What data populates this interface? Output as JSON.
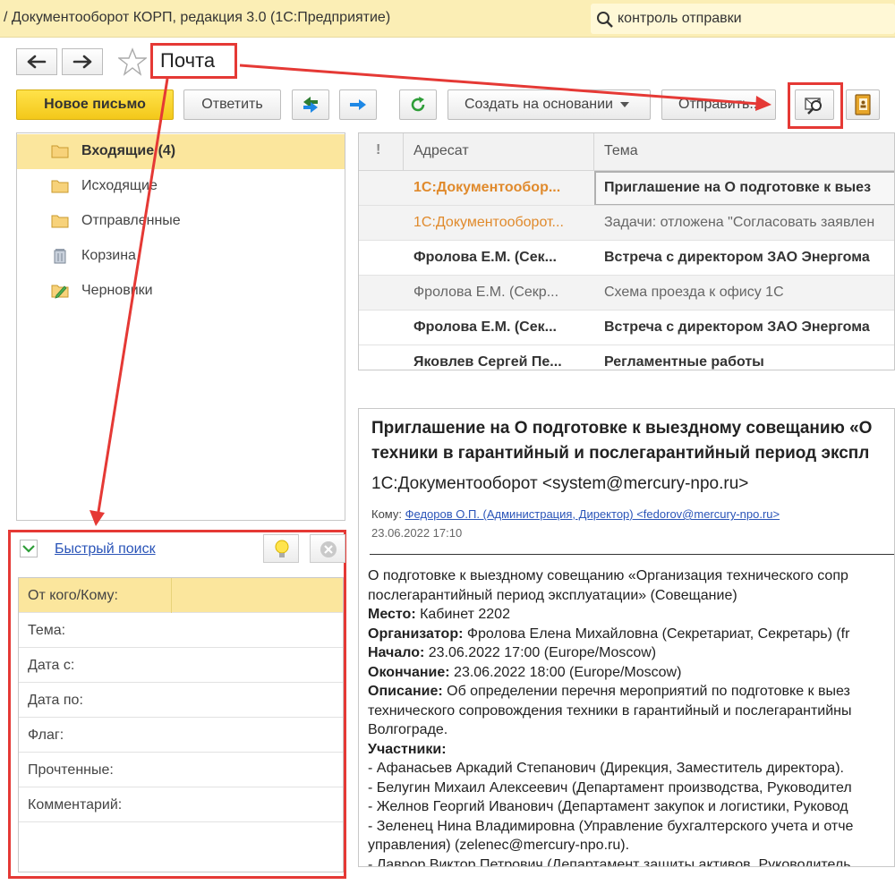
{
  "window": {
    "title": "/ Документооборот КОРП, редакция 3.0  (1С:Предприятие)",
    "search_value": "контроль отправки"
  },
  "page": {
    "title": "Почта"
  },
  "toolbar": {
    "new_letter": "Новое письмо",
    "reply": "Ответить",
    "create_based_on": "Создать на основании",
    "send": "Отправить..."
  },
  "folders": [
    {
      "label": "Входящие (4)",
      "icon": "folder-icon",
      "selected": true
    },
    {
      "label": "Исходящие",
      "icon": "folder-icon"
    },
    {
      "label": "Отправленные",
      "icon": "folder-icon"
    },
    {
      "label": "Корзина",
      "icon": "trash-icon"
    },
    {
      "label": "Черновики",
      "icon": "draft-folder-icon"
    }
  ],
  "mail_list": {
    "columns": {
      "flag": "!",
      "addressee": "Адресат",
      "subject": "Тема"
    },
    "rows": [
      {
        "from": "1С:Документообор...",
        "subject": "Приглашение на О подготовке к выез",
        "style": "bold-orange",
        "selected": true
      },
      {
        "from": "1С:Документооборот...",
        "subject": "Задачи: отложена \"Согласовать заявлен",
        "style": "orange"
      },
      {
        "from": "Фролова Е.М. (Сек...",
        "subject": "Встреча с директором ЗАО Энергома",
        "style": "bold"
      },
      {
        "from": "Фролова Е.М. (Секр...",
        "subject": "Схема проезда к офису 1С",
        "style": "grey"
      },
      {
        "from": "Фролова Е.М. (Сек...",
        "subject": "Встреча с директором ЗАО Энергома",
        "style": "bold"
      },
      {
        "from": "Яковлев Сергей Пе...",
        "subject": "Регламентные работы",
        "style": "bold"
      }
    ]
  },
  "preview": {
    "subject_line1": "Приглашение на О подготовке к выездному совещанию «О",
    "subject_line2": "техники в гарантийный и послегарантийный период экспл",
    "from": "1С:Документооборот <system@mercury-npo.ru>",
    "to_label": "Кому:",
    "to_value": "Федоров О.П. (Администрация, Директор) <fedorov@mercury-npo.ru>",
    "date": "23.06.2022 17:10",
    "body": [
      {
        "label": "",
        "text": "О подготовке к выездному совещанию «Организация технического сопр"
      },
      {
        "label": "",
        "text": "послегарантийный период эксплуатации» (Совещание)"
      },
      {
        "label": "Место:",
        "text": " Кабинет 2202"
      },
      {
        "label": "Организатор:",
        "text": " Фролова Елена Михайловна (Секретариат, Секретарь) (fr"
      },
      {
        "label": "Начало:",
        "text": " 23.06.2022 17:00 (Europe/Moscow)"
      },
      {
        "label": "Окончание:",
        "text": " 23.06.2022 18:00 (Europe/Moscow)"
      },
      {
        "label": "Описание:",
        "text": " Об определении перечня мероприятий по подготовке к выез"
      },
      {
        "label": "",
        "text": "технического сопровождения техники в гарантийный и послегарантийны"
      },
      {
        "label": "",
        "text": "Волгограде."
      },
      {
        "label": "Участники:",
        "text": ""
      },
      {
        "label": "",
        "text": "- Афанасьев Аркадий Степанович (Дирекция, Заместитель директора)."
      },
      {
        "label": "",
        "text": "- Белугин Михаил Алексеевич (Департамент производства, Руководител"
      },
      {
        "label": "",
        "text": "- Желнов Георгий Иванович (Департамент закупок и логистики, Руковод"
      },
      {
        "label": "",
        "text": "- Зеленец Нина Владимировна (Управление бухгалтерского учета и отче"
      },
      {
        "label": "",
        "text": "управления) (zelenec@mercury-npo.ru)."
      },
      {
        "label": "",
        "text": "- Лаврор Виктор Петрович (Департамент защиты активов, Руководитель"
      }
    ]
  },
  "quick_search": {
    "title": "Быстрый поиск",
    "fields": [
      "От кого/Кому:",
      "Тема:",
      "Дата с:",
      "Дата по:",
      "Флаг:",
      "Прочтенные:",
      "Комментарий:"
    ]
  },
  "colors": {
    "titlebar": "#fbeeb5",
    "selection": "#fbe69d",
    "primary_button": "#f3c81a",
    "annotation": "#e53935",
    "link": "#2a54b8",
    "unread_orange": "#e08a2c"
  }
}
